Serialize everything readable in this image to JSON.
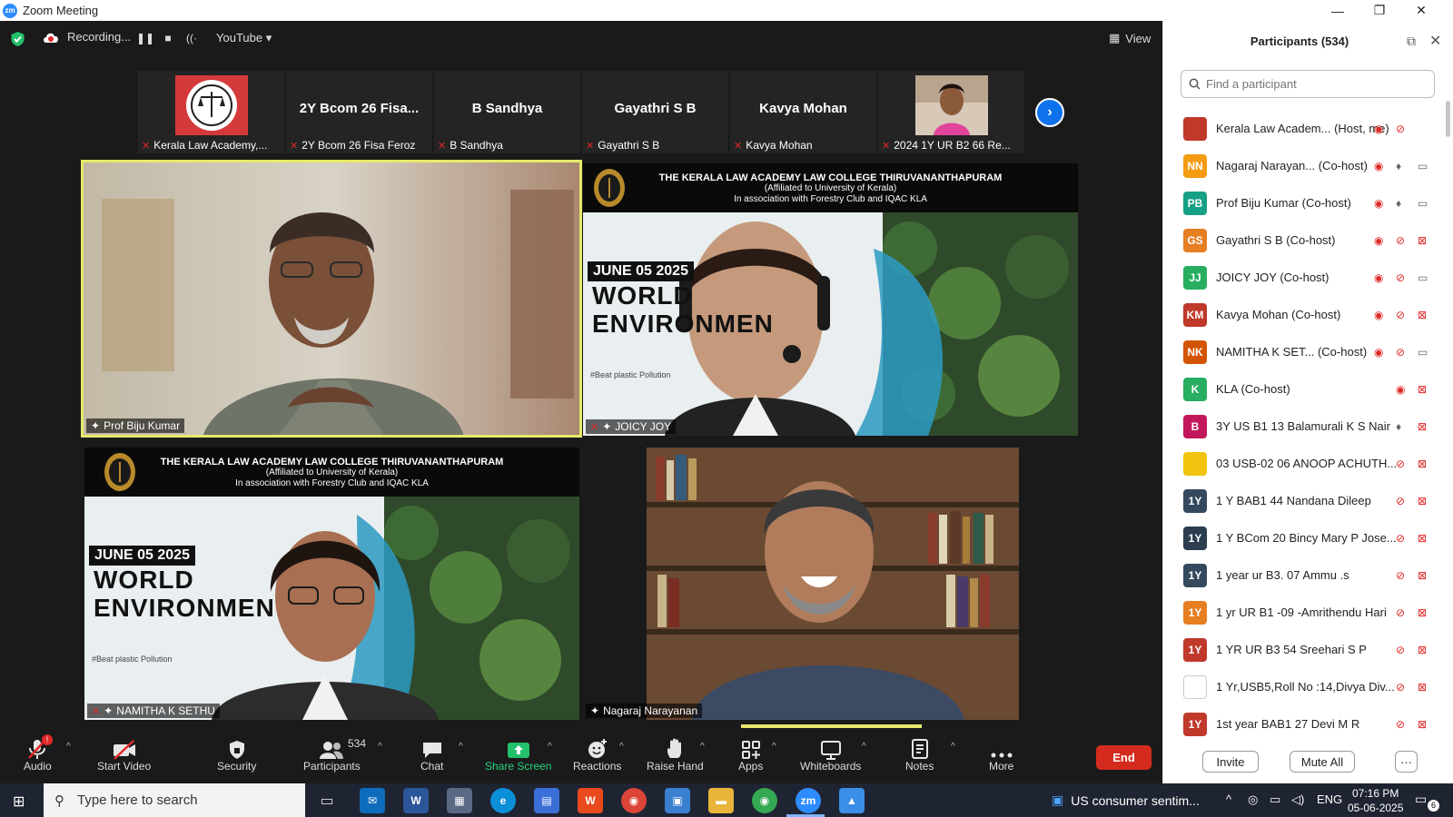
{
  "window": {
    "logo_text": "zm",
    "title": "Zoom Meeting",
    "minimize": "—",
    "restore": "❐",
    "close": "✕"
  },
  "topbar": {
    "recording_label": "Recording...",
    "pause": "❚❚",
    "stop": "■",
    "live": "((·",
    "stream_label": "YouTube",
    "stream_caret": "▾",
    "view_icon": "▦",
    "view_label": "View"
  },
  "thumbnails": [
    {
      "name": "",
      "label": "Kerala Law Academy,..."
    },
    {
      "name": "2Y Bcom 26 Fisa...",
      "label": "2Y Bcom 26 Fisa Feroz"
    },
    {
      "name": "B Sandhya",
      "label": "B Sandhya"
    },
    {
      "name": "Gayathri S B",
      "label": "Gayathri S B"
    },
    {
      "name": "Kavya Mohan",
      "label": "Kavya Mohan"
    },
    {
      "name": "",
      "label": "2024 1Y UR B2 66 Re..."
    }
  ],
  "next_icon": "›",
  "tiles": {
    "tile1": {
      "label": "Prof Biju Kumar"
    },
    "tile2": {
      "label": "JOICY JOY"
    },
    "tile3": {
      "label": "NAMITHA K SETHU"
    },
    "tile4": {
      "label": "Nagaraj Narayanan"
    }
  },
  "banner": {
    "line1": "THE KERALA LAW ACADEMY LAW COLLEGE THIRUVANANTHAPURAM",
    "line2": "(Affiliated to University of Kerala)",
    "line3": "In association with Forestry Club and IQAC KLA",
    "date": "JUNE 05 2025",
    "title1": "WORLD",
    "title2": "ENVIRONMEN",
    "hashtag": "#Beat plastic Pollution"
  },
  "toolbar": {
    "audio": "Audio",
    "audio_badge": "!",
    "start_video": "Start Video",
    "security": "Security",
    "participants": "Participants",
    "participants_count": "534",
    "chat": "Chat",
    "share_screen": "Share Screen",
    "reactions": "Reactions",
    "raise_hand": "Raise Hand",
    "apps": "Apps",
    "whiteboards": "Whiteboards",
    "notes": "Notes",
    "more": "More",
    "caret": "^",
    "end": "End"
  },
  "panel": {
    "title": "Participants (534)",
    "popout_icon": "⧉",
    "close_icon": "✕",
    "search_icon": "🔍",
    "search_placeholder": "Find a participant",
    "participants": [
      {
        "avatar": "",
        "color": "#c0392b",
        "name": "Kerala Law Academ...  (Host, me)"
      },
      {
        "avatar": "NN",
        "color": "#f39c12",
        "name": "Nagaraj Narayan...  (Co-host)"
      },
      {
        "avatar": "PB",
        "color": "#16a085",
        "name": "Prof Biju Kumar (Co-host)"
      },
      {
        "avatar": "GS",
        "color": "#e67e22",
        "name": "Gayathri S B (Co-host)"
      },
      {
        "avatar": "JJ",
        "color": "#27ae60",
        "name": "JOICY JOY (Co-host)"
      },
      {
        "avatar": "KM",
        "color": "#c0392b",
        "name": "Kavya Mohan (Co-host)"
      },
      {
        "avatar": "NK",
        "color": "#d35400",
        "name": "NAMITHA K SET...   (Co-host)"
      },
      {
        "avatar": "K",
        "color": "#27ae60",
        "name": "KLA (Co-host)"
      },
      {
        "avatar": "B",
        "color": "#c2185b",
        "name": "3Y US B1 13 Balamurali K S Nair"
      },
      {
        "avatar": "",
        "color": "#f1c40f",
        "name": "03 USB-02 06 ANOOP ACHUTH..."
      },
      {
        "avatar": "1Y",
        "color": "#34495e",
        "name": "1 Y BAB1 44 Nandana Dileep"
      },
      {
        "avatar": "1Y",
        "color": "#2c3e50",
        "name": "1 Y BCom 20 Bincy Mary P Jose..."
      },
      {
        "avatar": "1Y",
        "color": "#34495e",
        "name": "1 year ur B3. 07 Ammu .s"
      },
      {
        "avatar": "1Y",
        "color": "#e67e22",
        "name": "1 yr UR B1 -09 -Amrithendu Hari"
      },
      {
        "avatar": "1Y",
        "color": "#c0392b",
        "name": "1 YR UR B3 54 Sreehari S P"
      },
      {
        "avatar": "",
        "color": "#ffffff",
        "name": "1 Yr,USB5,Roll No :14,Divya Div..."
      },
      {
        "avatar": "1Y",
        "color": "#c0392b",
        "name": "1st year BAB1 27 Devi M R"
      }
    ],
    "invite": "Invite",
    "mute_all": "Mute All",
    "more": "···"
  },
  "taskbar": {
    "start_icon": "⊞",
    "search_icon": "⚲",
    "search_text": "Type here to search",
    "news": "US consumer sentim...",
    "news_icon": "▣",
    "tray_caret": "^",
    "lang": "ENG",
    "time": "07:16 PM",
    "date": "05-06-2025",
    "notif": "6"
  }
}
